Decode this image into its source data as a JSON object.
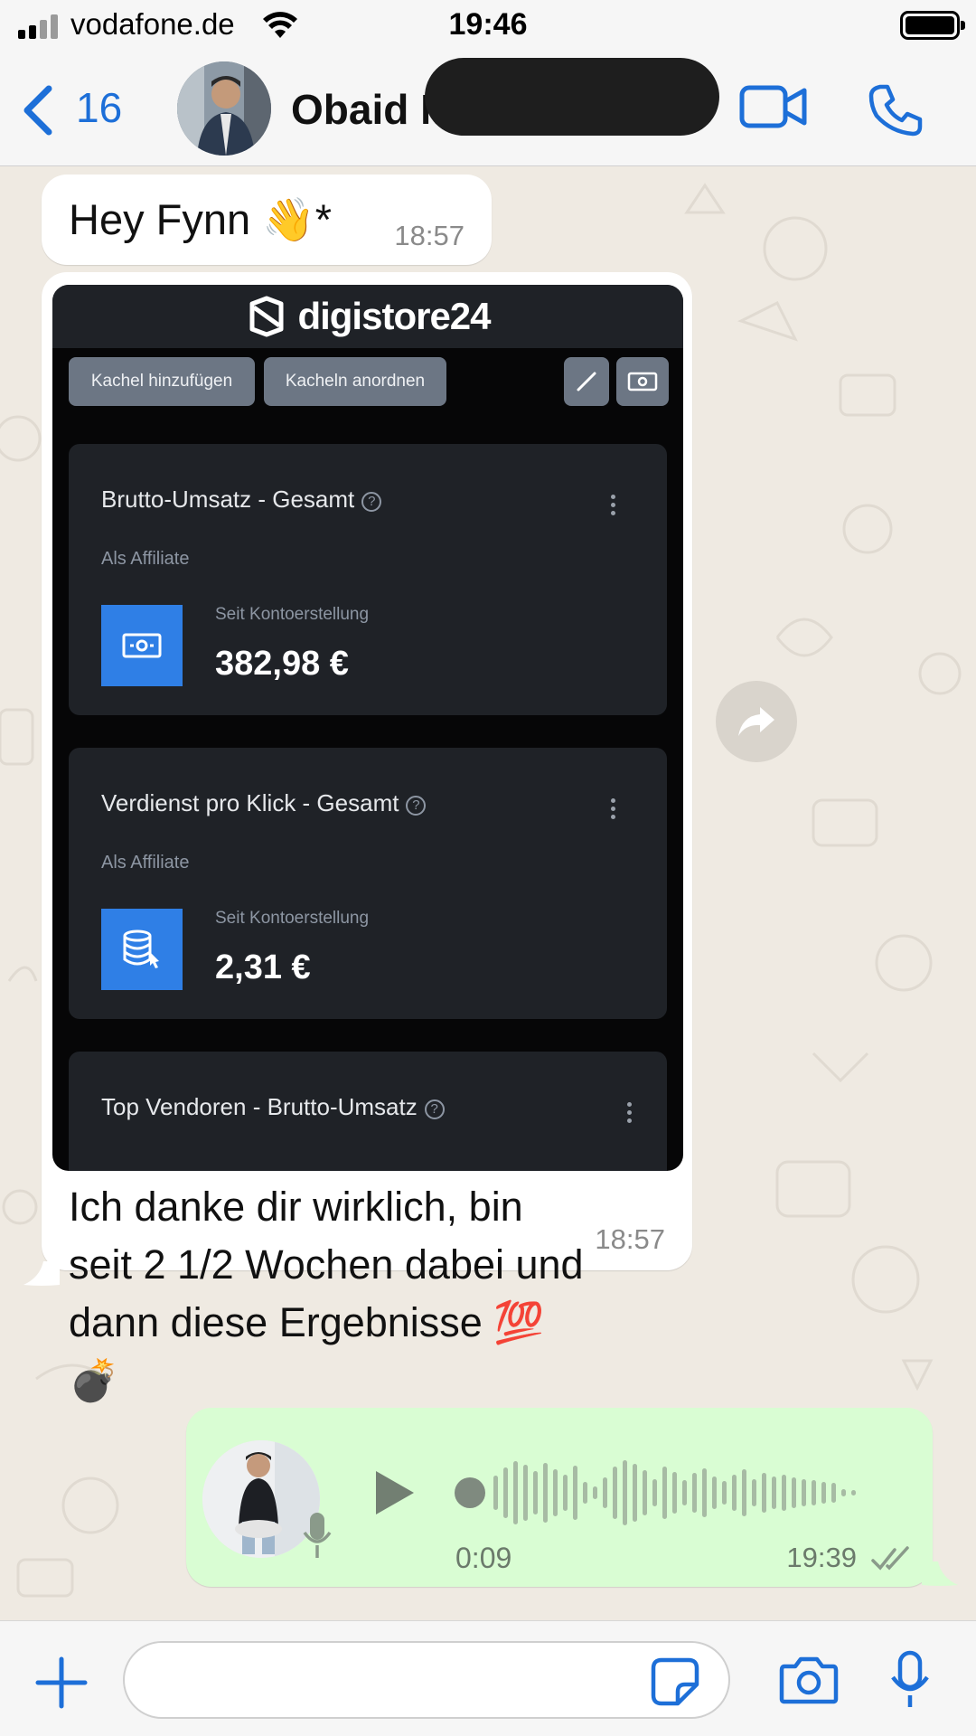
{
  "status_bar": {
    "carrier": "vodafone.de",
    "time": "19:46"
  },
  "header": {
    "back_count": "16",
    "contact_name": "Obaid M"
  },
  "messages": {
    "msg1": {
      "text": "Hey Fynn 👋*",
      "time": "18:57"
    },
    "msg2": {
      "caption": "Ich danke dir wirklich, bin seit 2 1/2 Wochen dabei und dann diese Ergebnisse 💯 💣",
      "time": "18:57",
      "image": {
        "logo_text": "digistore24",
        "buttons": [
          "Kachel hinzufügen",
          "Kacheln anordnen"
        ],
        "cards": [
          {
            "title": "Brutto-Umsatz - Gesamt",
            "subtitle": "Als Affiliate",
            "since": "Seit Kontoerstellung",
            "value": "382,98 €"
          },
          {
            "title": "Verdienst pro Klick - Gesamt",
            "subtitle": "Als Affiliate",
            "since": "Seit Kontoerstellung",
            "value": "2,31 €"
          },
          {
            "title": "Top Vendoren - Brutto-Umsatz"
          }
        ]
      }
    },
    "voice": {
      "duration": "0:09",
      "time": "19:39"
    }
  },
  "colors": {
    "ios_blue": "#1d6fd8",
    "outgoing_bubble": "#d9fdd3",
    "chat_bg": "#efeae2",
    "digistore_accent": "#2f7fe6"
  },
  "input_bar": {
    "placeholder": ""
  },
  "icons": [
    "signal-icon",
    "wifi-icon",
    "battery-icon",
    "back-chevron-icon",
    "video-call-icon",
    "phone-icon",
    "share-forward-icon",
    "play-icon",
    "mic-icon",
    "plus-icon",
    "sticker-icon",
    "camera-icon",
    "double-check-icon"
  ]
}
